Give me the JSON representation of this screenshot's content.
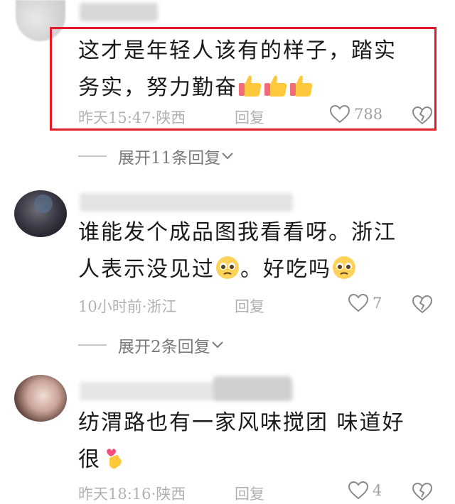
{
  "comments": [
    {
      "text_line1": "这才是年轻人该有的样子，踏实",
      "text_line2": "务实，努力勤奋",
      "time": "昨天15:47",
      "location": "陕西",
      "reply": "回复",
      "likes": "788",
      "emoji": "thumbs-up-icon"
    },
    {
      "text_line1": "谁能发个成品图我看看呀。浙江",
      "text_line2_a": "人表示没见过",
      "text_line2_b": "。好吃吗",
      "time": "10小时前",
      "location": "浙江",
      "reply": "回复",
      "likes": "7",
      "emoji": "pleading-face-icon"
    },
    {
      "text_line1": "纺渭路也有一家风味搅团 味道好",
      "text_line2": "很",
      "time": "昨天18:16",
      "location": "陕西",
      "reply": "回复",
      "likes": "4",
      "emoji": "finger-heart-icon"
    }
  ],
  "expand": [
    {
      "label": "展开11条回复"
    },
    {
      "label": "展开2条回复"
    }
  ],
  "colors": {
    "highlight": "#e21b2a",
    "meta": "#b1b1b1"
  }
}
